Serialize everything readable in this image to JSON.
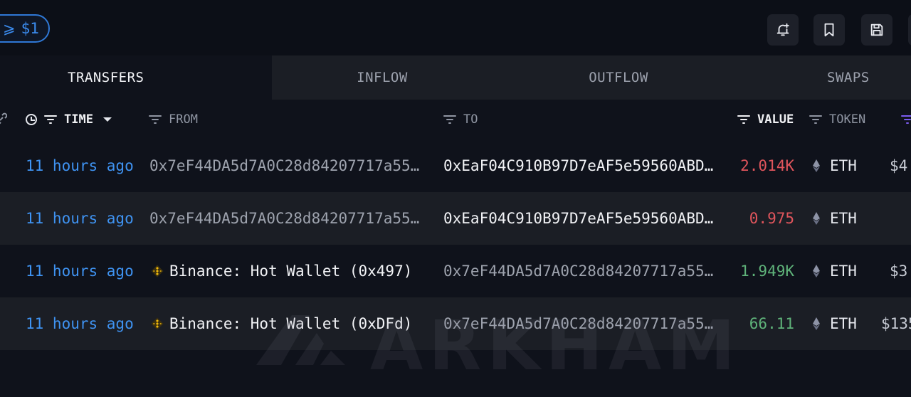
{
  "filter": {
    "symbol": "⩾",
    "amount": "$1"
  },
  "toolbar": {
    "icons": [
      "bell-plus-icon",
      "bookmark-icon",
      "save-icon"
    ]
  },
  "tabs": [
    "TRANSFERS",
    "INFLOW",
    "OUTFLOW",
    "SWAPS"
  ],
  "active_tab": "TRANSFERS",
  "columns": {
    "time": "TIME",
    "from": "FROM",
    "to": "TO",
    "value": "VALUE",
    "token": "TOKEN"
  },
  "rows": [
    {
      "time": "11 hours ago",
      "from": "0x7eF44DA5d7A0C28d84207717a55…",
      "to": "0xEaF04C910B97D7eAF5e59560ABD…",
      "value": "2.014K",
      "value_color": "#e0555c",
      "token": "ETH",
      "usd": "$4"
    },
    {
      "time": "11 hours ago",
      "from": "0x7eF44DA5d7A0C28d84207717a55…",
      "to": "0xEaF04C910B97D7eAF5e59560ABD…",
      "value": "0.975",
      "value_color": "#e0555c",
      "token": "ETH",
      "usd": ""
    },
    {
      "time": "11 hours ago",
      "from": "Binance: Hot Wallet (0x497)",
      "to": "0x7eF44DA5d7A0C28d84207717a55…",
      "value": "1.949K",
      "value_color": "#5fb37a",
      "token": "ETH",
      "usd": "$3"
    },
    {
      "time": "11 hours ago",
      "from": "Binance: Hot Wallet (0xDFd)",
      "to": "0x7eF44DA5d7A0C28d84207717a55…",
      "value": "66.11",
      "value_color": "#5fb37a",
      "token": "ETH",
      "usd": "$135"
    }
  ],
  "watermark": "ARKHAM",
  "colors": {
    "accent": "#3f93f2",
    "negative": "#e0555c",
    "positive": "#5fb37a"
  }
}
